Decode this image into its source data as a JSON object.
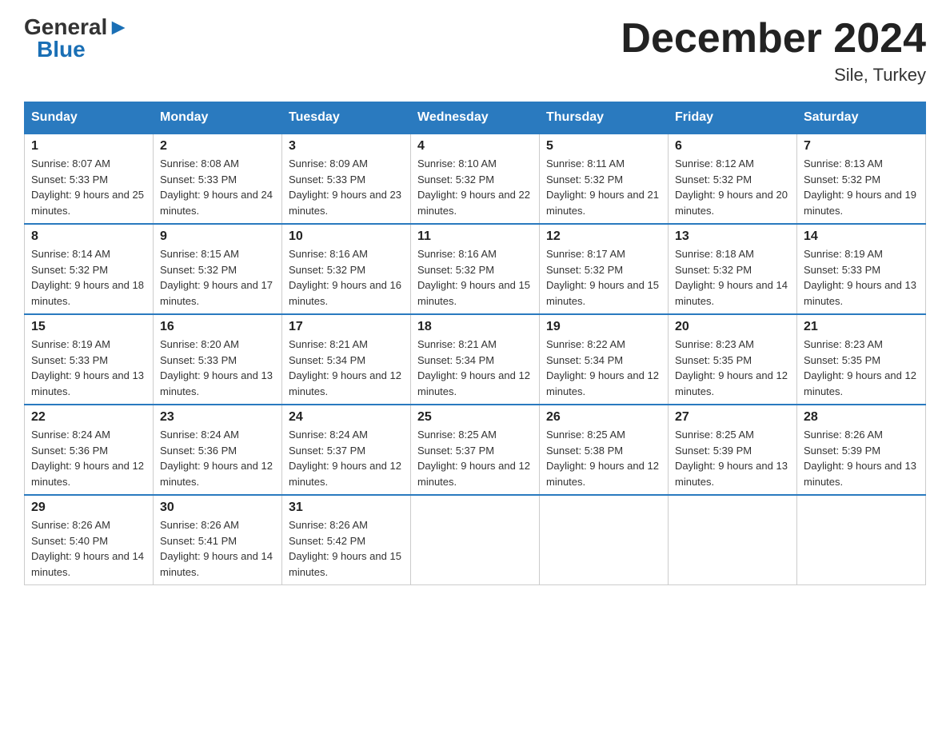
{
  "logo": {
    "general": "General",
    "blue": "Blue",
    "triangle": true
  },
  "title": "December 2024",
  "subtitle": "Sile, Turkey",
  "days_of_week": [
    "Sunday",
    "Monday",
    "Tuesday",
    "Wednesday",
    "Thursday",
    "Friday",
    "Saturday"
  ],
  "weeks": [
    [
      {
        "day": 1,
        "sunrise": "8:07 AM",
        "sunset": "5:33 PM",
        "daylight": "9 hours and 25 minutes."
      },
      {
        "day": 2,
        "sunrise": "8:08 AM",
        "sunset": "5:33 PM",
        "daylight": "9 hours and 24 minutes."
      },
      {
        "day": 3,
        "sunrise": "8:09 AM",
        "sunset": "5:33 PM",
        "daylight": "9 hours and 23 minutes."
      },
      {
        "day": 4,
        "sunrise": "8:10 AM",
        "sunset": "5:32 PM",
        "daylight": "9 hours and 22 minutes."
      },
      {
        "day": 5,
        "sunrise": "8:11 AM",
        "sunset": "5:32 PM",
        "daylight": "9 hours and 21 minutes."
      },
      {
        "day": 6,
        "sunrise": "8:12 AM",
        "sunset": "5:32 PM",
        "daylight": "9 hours and 20 minutes."
      },
      {
        "day": 7,
        "sunrise": "8:13 AM",
        "sunset": "5:32 PM",
        "daylight": "9 hours and 19 minutes."
      }
    ],
    [
      {
        "day": 8,
        "sunrise": "8:14 AM",
        "sunset": "5:32 PM",
        "daylight": "9 hours and 18 minutes."
      },
      {
        "day": 9,
        "sunrise": "8:15 AM",
        "sunset": "5:32 PM",
        "daylight": "9 hours and 17 minutes."
      },
      {
        "day": 10,
        "sunrise": "8:16 AM",
        "sunset": "5:32 PM",
        "daylight": "9 hours and 16 minutes."
      },
      {
        "day": 11,
        "sunrise": "8:16 AM",
        "sunset": "5:32 PM",
        "daylight": "9 hours and 15 minutes."
      },
      {
        "day": 12,
        "sunrise": "8:17 AM",
        "sunset": "5:32 PM",
        "daylight": "9 hours and 15 minutes."
      },
      {
        "day": 13,
        "sunrise": "8:18 AM",
        "sunset": "5:32 PM",
        "daylight": "9 hours and 14 minutes."
      },
      {
        "day": 14,
        "sunrise": "8:19 AM",
        "sunset": "5:33 PM",
        "daylight": "9 hours and 13 minutes."
      }
    ],
    [
      {
        "day": 15,
        "sunrise": "8:19 AM",
        "sunset": "5:33 PM",
        "daylight": "9 hours and 13 minutes."
      },
      {
        "day": 16,
        "sunrise": "8:20 AM",
        "sunset": "5:33 PM",
        "daylight": "9 hours and 13 minutes."
      },
      {
        "day": 17,
        "sunrise": "8:21 AM",
        "sunset": "5:34 PM",
        "daylight": "9 hours and 12 minutes."
      },
      {
        "day": 18,
        "sunrise": "8:21 AM",
        "sunset": "5:34 PM",
        "daylight": "9 hours and 12 minutes."
      },
      {
        "day": 19,
        "sunrise": "8:22 AM",
        "sunset": "5:34 PM",
        "daylight": "9 hours and 12 minutes."
      },
      {
        "day": 20,
        "sunrise": "8:23 AM",
        "sunset": "5:35 PM",
        "daylight": "9 hours and 12 minutes."
      },
      {
        "day": 21,
        "sunrise": "8:23 AM",
        "sunset": "5:35 PM",
        "daylight": "9 hours and 12 minutes."
      }
    ],
    [
      {
        "day": 22,
        "sunrise": "8:24 AM",
        "sunset": "5:36 PM",
        "daylight": "9 hours and 12 minutes."
      },
      {
        "day": 23,
        "sunrise": "8:24 AM",
        "sunset": "5:36 PM",
        "daylight": "9 hours and 12 minutes."
      },
      {
        "day": 24,
        "sunrise": "8:24 AM",
        "sunset": "5:37 PM",
        "daylight": "9 hours and 12 minutes."
      },
      {
        "day": 25,
        "sunrise": "8:25 AM",
        "sunset": "5:37 PM",
        "daylight": "9 hours and 12 minutes."
      },
      {
        "day": 26,
        "sunrise": "8:25 AM",
        "sunset": "5:38 PM",
        "daylight": "9 hours and 12 minutes."
      },
      {
        "day": 27,
        "sunrise": "8:25 AM",
        "sunset": "5:39 PM",
        "daylight": "9 hours and 13 minutes."
      },
      {
        "day": 28,
        "sunrise": "8:26 AM",
        "sunset": "5:39 PM",
        "daylight": "9 hours and 13 minutes."
      }
    ],
    [
      {
        "day": 29,
        "sunrise": "8:26 AM",
        "sunset": "5:40 PM",
        "daylight": "9 hours and 14 minutes."
      },
      {
        "day": 30,
        "sunrise": "8:26 AM",
        "sunset": "5:41 PM",
        "daylight": "9 hours and 14 minutes."
      },
      {
        "day": 31,
        "sunrise": "8:26 AM",
        "sunset": "5:42 PM",
        "daylight": "9 hours and 15 minutes."
      },
      null,
      null,
      null,
      null
    ]
  ]
}
